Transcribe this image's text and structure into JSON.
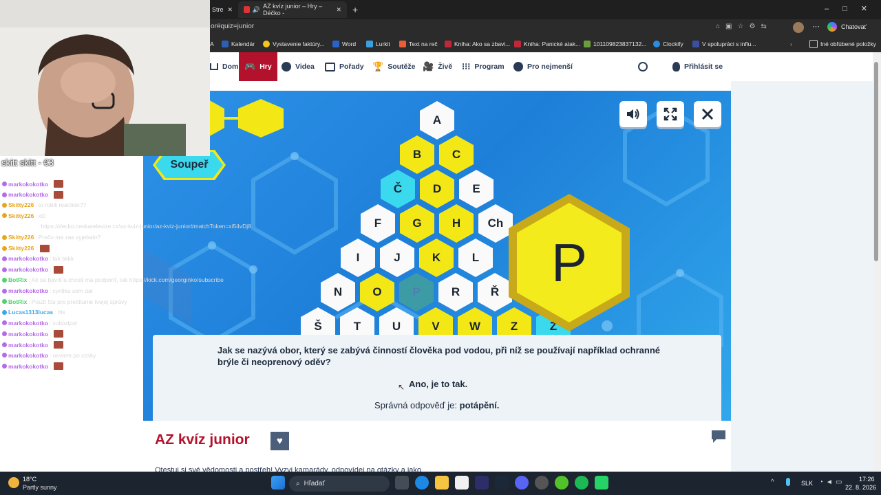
{
  "browser": {
    "tabs": [
      {
        "label": "Stre"
      },
      {
        "label": "AZ kvíz junior – Hry – Déčko -"
      }
    ],
    "address": "or#quiz=junior",
    "chat_label": "Chatovať",
    "bookmarks": [
      {
        "label": "A"
      },
      {
        "label": "Kalendár"
      },
      {
        "label": "Vystavenie faktúry..."
      },
      {
        "label": "Word"
      },
      {
        "label": "Lurkit"
      },
      {
        "label": "Text na reč"
      },
      {
        "label": "Kniha: Ako sa zbavi..."
      },
      {
        "label": "Kniha: Panické atak..."
      },
      {
        "label": "101109823837132..."
      },
      {
        "label": "Clockify"
      },
      {
        "label": "V spolupráci s influ..."
      }
    ],
    "other_bookmarks": "Iné obľúbené položky"
  },
  "site_nav": {
    "items": [
      {
        "label": "Domů"
      },
      {
        "label": "Hry"
      },
      {
        "label": "Videa"
      },
      {
        "label": "Pořady"
      },
      {
        "label": "Soutěže"
      },
      {
        "label": "Živě"
      },
      {
        "label": "Program"
      },
      {
        "label": "Pro nejmenší"
      }
    ],
    "login": "Přihlásit se"
  },
  "game": {
    "opponent_label": "Soupeř",
    "current_letter": "P",
    "board": {
      "rows": [
        [
          "A"
        ],
        [
          "B",
          "C"
        ],
        [
          "Č",
          "D",
          "E"
        ],
        [
          "F",
          "G",
          "H",
          "Ch"
        ],
        [
          "I",
          "J",
          "K",
          "L"
        ],
        [
          "N",
          "O",
          "P",
          "R",
          "Ř"
        ],
        [
          "Š",
          "T",
          "U",
          "V",
          "W",
          "Z",
          "Ž"
        ]
      ]
    },
    "question": "Jak se nazývá obor, který se zabývá činností člověka pod vodou, při níž se používají například ochranné brýle či neoprenový oděv?",
    "feedback": "Ano, je to tak.",
    "answer_prefix": "Správná odpověď je:",
    "answer": "potápění."
  },
  "page": {
    "title": "AZ kvíz junior",
    "description": "Otestuj si své vědomosti a postřeh! Vyzvi kamarády, odpovídej na otázky a jako"
  },
  "stream": {
    "title": "skitt skitt - €3",
    "chat": [
      {
        "user": "markokokotko",
        "message": "",
        "color": "#b46be8",
        "emote": true
      },
      {
        "user": "markokokotko",
        "message": "",
        "color": "#b46be8",
        "emote": true
      },
      {
        "user": "Skitty226",
        "message": "to robili reaction??",
        "color": "#e8a51e",
        "emote": false
      },
      {
        "user": "Skitty226",
        "message": "xD",
        "color": "#e8a51e",
        "emote": false
      },
      {
        "user": "georginko",
        "message": "https://decko.ceskatelevize.cz/az-kviz-junior/az-kviz-junior#matchToken=xi54vDj8",
        "color": "#ffffff",
        "emote": false
      },
      {
        "user": "Skitty226",
        "message": "Prečo ma zas vyjebalo?",
        "color": "#e8a51e",
        "emote": false
      },
      {
        "user": "Skitty226",
        "message": "",
        "color": "#e8a51e",
        "emote": true
      },
      {
        "user": "markokokotko",
        "message": "tak skkk",
        "color": "#b46be8",
        "emote": false
      },
      {
        "user": "markokokotko",
        "message": "",
        "color": "#b46be8",
        "emote": true
      },
      {
        "user": "BotRix",
        "message": "Ak sa bavíš a chceš ma podporiť, tak https://kick.com/georginko/subscribe",
        "color": "#4fd36b",
        "emote": false
      },
      {
        "user": "markokokotko",
        "message": "cyrilika som dal",
        "color": "#b46be8",
        "emote": false
      },
      {
        "user": "BotRix",
        "message": "Použi !tts pre prečítanie tvojej správy",
        "color": "#4fd36b",
        "emote": false
      },
      {
        "user": "Lucas1313lucas",
        "message": "!tts",
        "color": "#3fa7e8",
        "emote": false
      },
      {
        "user": "markokokotko",
        "message": "volsxdpol",
        "color": "#b46be8",
        "emote": false
      },
      {
        "user": "markokokotko",
        "message": "",
        "color": "#b46be8",
        "emote": true
      },
      {
        "user": "markokokotko",
        "message": "",
        "color": "#b46be8",
        "emote": true
      },
      {
        "user": "markokokotko",
        "message": "neviem po czsky",
        "color": "#b46be8",
        "emote": false
      },
      {
        "user": "markokokotko",
        "message": "",
        "color": "#b46be8",
        "emote": true
      }
    ]
  },
  "taskbar": {
    "weather_temp": "18°C",
    "weather_desc": "Partly sunny",
    "search_label": "Hľadať",
    "language": "SLK",
    "time": "17:26",
    "date": "22. 8. 2026"
  },
  "colors": {
    "brand_red": "#b3122c",
    "game_blue": "#2e92e8",
    "hex_yellow": "#f3e816",
    "hex_cyan": "#3ad9ee"
  }
}
